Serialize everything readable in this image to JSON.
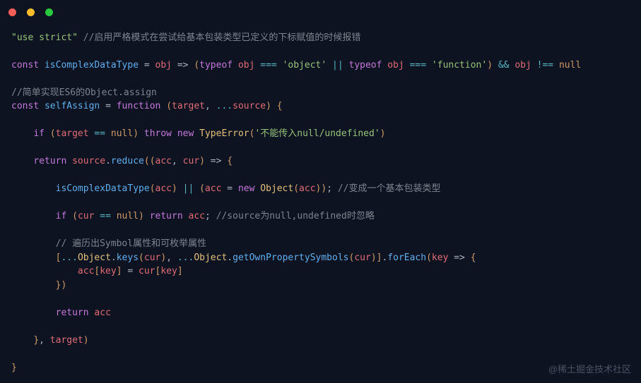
{
  "titlebar": {
    "dots": [
      "red",
      "yellow",
      "green"
    ]
  },
  "t": {
    "use_strict": "\"use strict\"",
    "c1": "//启用严格模式在尝试给基本包装类型已定义的下标赋值的时候报错",
    "const_": "const",
    "isComplex": "isComplexDataType",
    "eq": " = ",
    "obj": "obj",
    "arrow": " => ",
    "lp": "(",
    "rp": ")",
    "typeof_": "typeof",
    "sp": " ",
    "teq": "===",
    "s_object": "'object'",
    "or": "||",
    "s_function": "'function'",
    "and": "&&",
    "neq": "!==",
    "null_": "null",
    "c2": "//简单实现ES6的Object.assign",
    "selfAssign": "selfAssign",
    "function_": "function",
    "target": "target",
    "comma": ", ",
    "spread": "...",
    "source": "source",
    "lb": "{",
    "rb": "}",
    "if_": "if",
    "eqeq": "==",
    "throw_": "throw",
    "new_": "new",
    "TypeError_": "TypeError",
    "s_err": "'不能传入null/undefined'",
    "return_": "return",
    "dot": ".",
    "reduce": "reduce",
    "acc": "acc",
    "cur": "cur",
    "assign": " = ",
    "Object_": "Object",
    "semi": ";",
    "c3": "//变成一个基本包装类型",
    "c4": "//source为null,undefined时忽略",
    "c5": "// 遍历出Symbol属性和可枚举属性",
    "lbr": "[",
    "rbr": "]",
    "keys": "keys",
    "getOwnPropertySymbols": "getOwnPropertySymbols",
    "forEach": "forEach",
    "key": "key",
    "watermark": "@稀土掘金技术社区"
  }
}
